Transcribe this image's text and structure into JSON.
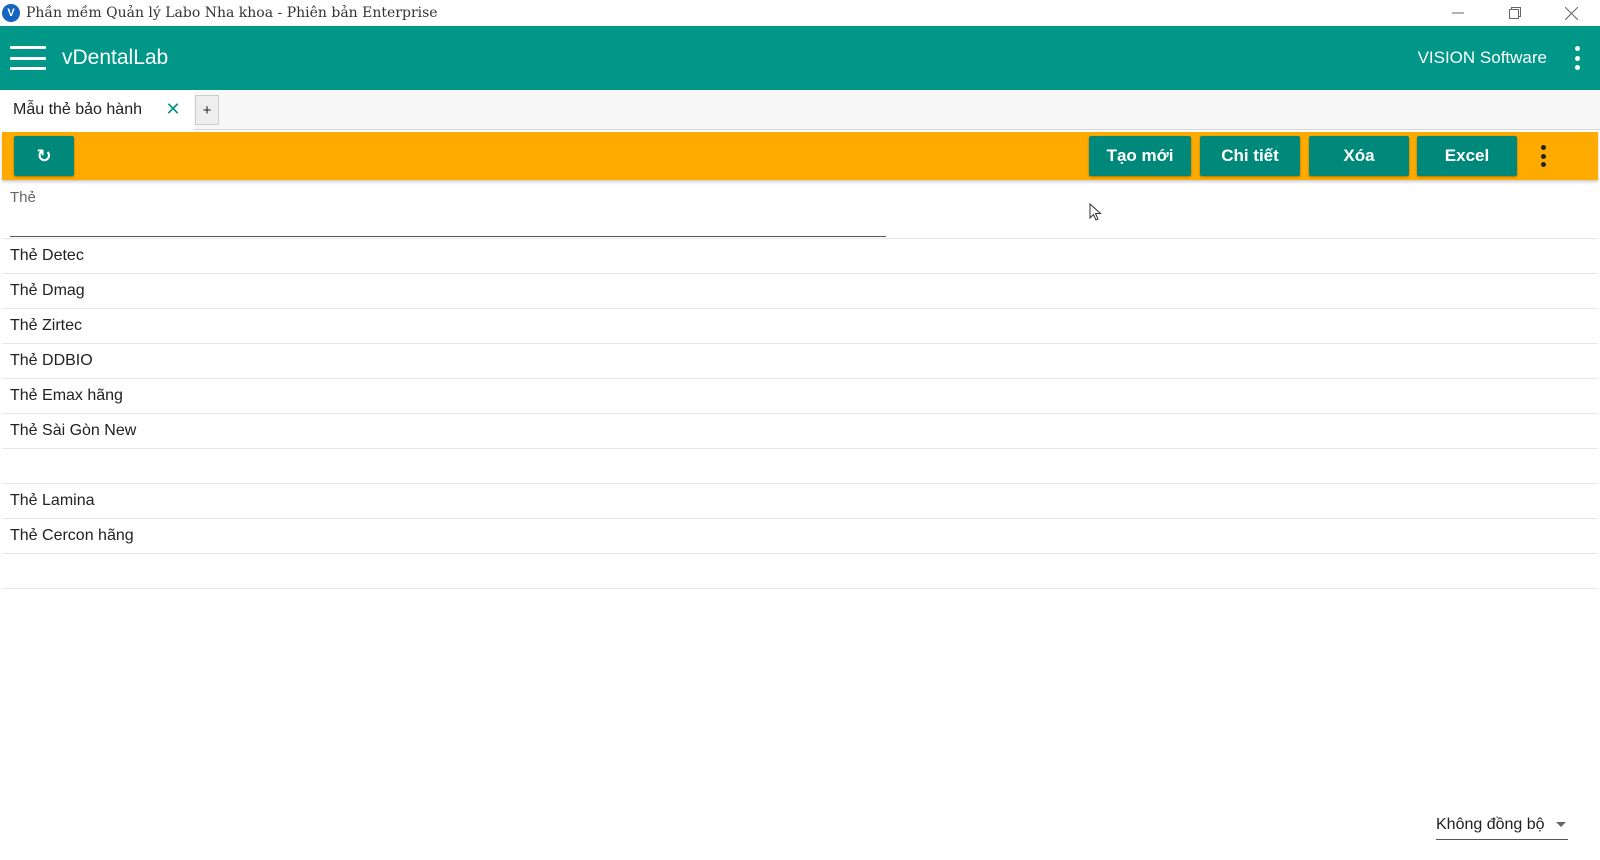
{
  "window": {
    "title": "Phần mềm Quản lý Labo Nha khoa - Phiên bản Enterprise",
    "logo_letter": "V"
  },
  "appbar": {
    "app_name": "vDentalLab",
    "company": "VISION Software",
    "menu_icon": "hamburger-icon",
    "more_icon": "more-vert-icon"
  },
  "tabs": [
    {
      "label": "Mẫu thẻ bảo hành",
      "close_icon": "close-icon"
    }
  ],
  "tab_add_label": "+",
  "toolbar": {
    "refresh_icon": "refresh-icon",
    "refresh_glyph": "↻",
    "create_label": "Tạo mới",
    "detail_label": "Chi tiết",
    "delete_label": "Xóa",
    "excel_label": "Excel"
  },
  "grid": {
    "column_title": "Thẻ",
    "rows": [
      "Thẻ Detec",
      "Thẻ Dmag",
      "Thẻ Zirtec",
      "Thẻ DDBIO",
      "Thẻ Emax hãng",
      "Thẻ Sài Gòn New",
      "",
      "Thẻ Lamina",
      "Thẻ Cercon hãng",
      ""
    ]
  },
  "sync": {
    "selected": "Không đồng bộ"
  },
  "colors": {
    "primary": "#009688",
    "toolbar": "#ffaa00",
    "button": "#00897b"
  }
}
